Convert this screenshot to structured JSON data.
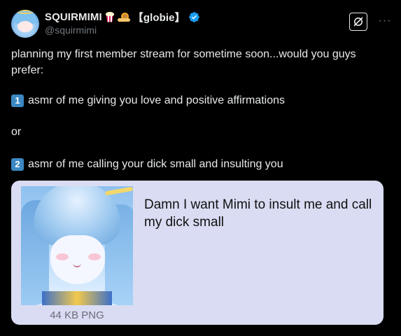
{
  "post": {
    "display_name": "SQUIRMIMI",
    "name_suffix": "【globie】",
    "handle": "@squirmimi",
    "verified": true,
    "emojis": [
      "popcorn-icon",
      "snail-icon"
    ],
    "text_line1": "planning my first member stream for sometime soon...would you guys prefer:",
    "option1_number": "1",
    "option1_text": "asmr of me giving you love and positive affirmations",
    "or_text": "or",
    "option2_number": "2",
    "option2_text": "asmr of me calling your dick small and insulting you"
  },
  "card": {
    "quote_text": "Damn I want Mimi to insult me and call my dick small",
    "file_label": "44 KB PNG",
    "background": "#d9dcf2"
  },
  "colors": {
    "background": "#000000",
    "text": "#e7e9ea",
    "secondary": "#71767b",
    "verified": "#1d9bf0",
    "keycap": "#3b88c3"
  },
  "icons": {
    "toolbar": "grok-icon",
    "more": "more-icon",
    "verified": "verified-badge-icon"
  }
}
